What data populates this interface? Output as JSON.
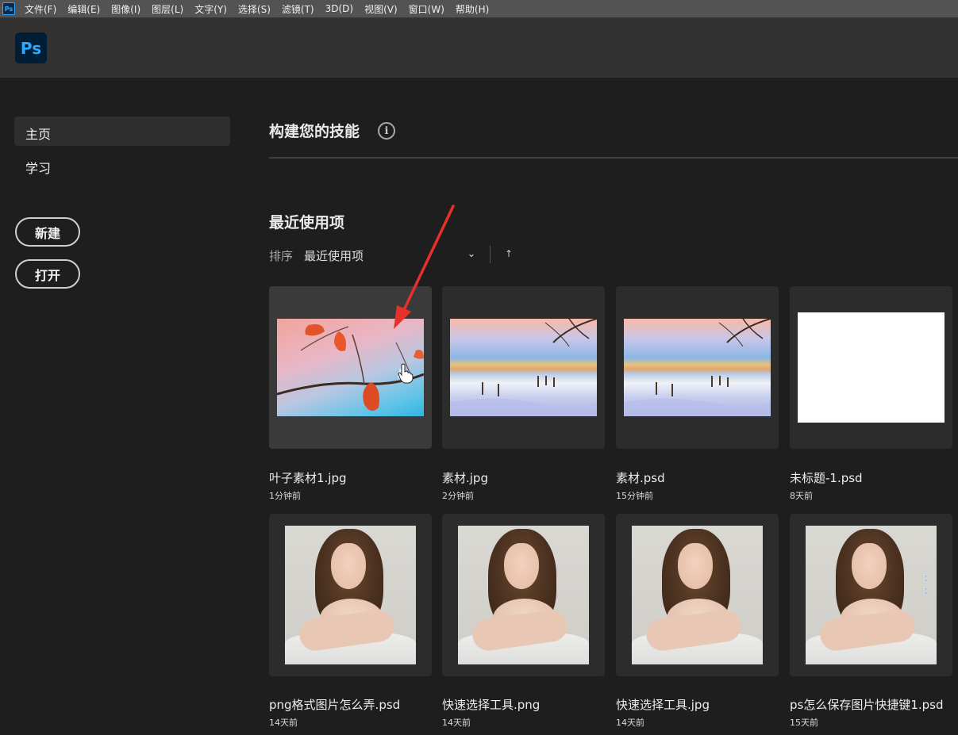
{
  "menubar": {
    "items": [
      "文件(F)",
      "编辑(E)",
      "图像(I)",
      "图层(L)",
      "文字(Y)",
      "选择(S)",
      "滤镜(T)",
      "3D(D)",
      "视图(V)",
      "窗口(W)",
      "帮助(H)"
    ]
  },
  "header": {
    "logo": "Ps"
  },
  "sidebar": {
    "home": "主页",
    "learn": "学习",
    "new_button": "新建",
    "open_button": "打开"
  },
  "main": {
    "skills_title": "构建您的技能",
    "info_icon": "i",
    "recent_title": "最近使用项",
    "sort_label": "排序",
    "sort_value": "最近使用项",
    "sort_chevron": "⌄",
    "sort_direction": "↑"
  },
  "files": [
    {
      "name": "叶子素材1.jpg",
      "time": "1分钟前",
      "thumb": "leaf"
    },
    {
      "name": "素材.jpg",
      "time": "2分钟前",
      "thumb": "snow"
    },
    {
      "name": "素材.psd",
      "time": "15分钟前",
      "thumb": "snow"
    },
    {
      "name": "未标题-1.psd",
      "time": "8天前",
      "thumb": "white"
    },
    {
      "name": "png格式图片怎么弄.psd",
      "time": "14天前",
      "thumb": "portrait"
    },
    {
      "name": "快速选择工具.png",
      "time": "14天前",
      "thumb": "portrait"
    },
    {
      "name": "快速选择工具.jpg",
      "time": "14天前",
      "thumb": "portrait"
    },
    {
      "name": "ps怎么保存图片快捷键1.psd",
      "time": "15天前",
      "thumb": "portrait"
    }
  ],
  "colors": {
    "accent": "#31a8ff",
    "annotation_arrow": "#e8302a"
  }
}
